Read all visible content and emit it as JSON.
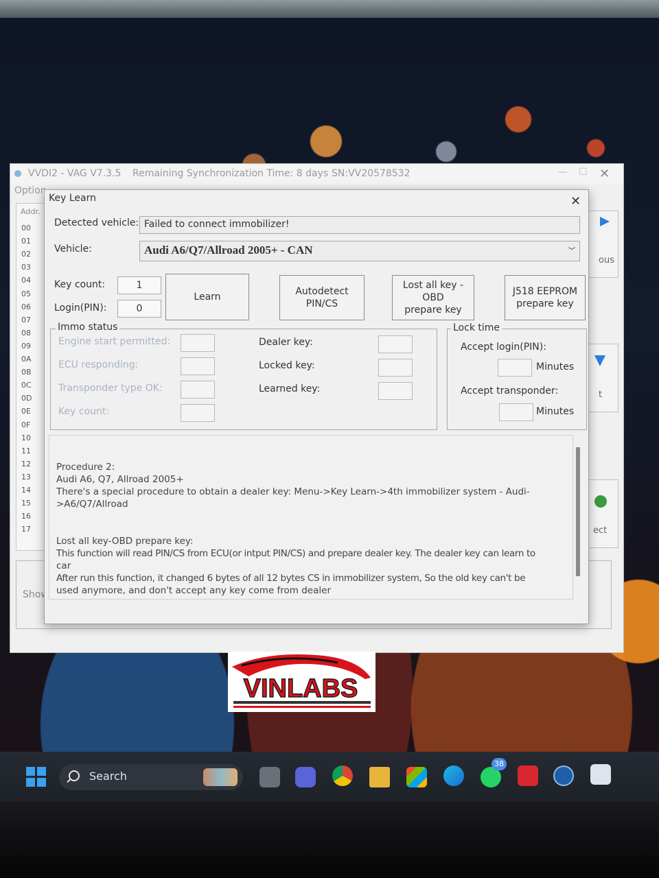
{
  "main_window": {
    "title": "VVDI2 - VAG V7.3.5",
    "sync_text": "Remaining Synchronization Time: 8 days",
    "serial": "SN:VV20578532",
    "menu_partial": "Option",
    "address_header": "Addr.",
    "address_rows": [
      "00",
      "01",
      "02",
      "03",
      "04",
      "05",
      "06",
      "07",
      "08",
      "09",
      "0A",
      "0B",
      "0C",
      "0D",
      "0E",
      "0F",
      "10",
      "11",
      "12",
      "13",
      "14",
      "15",
      "16",
      "17"
    ],
    "right_buttons": [
      "ous",
      "t",
      "ect"
    ],
    "show_label": "Show"
  },
  "dialog": {
    "title": "Key Learn",
    "detected_vehicle_label": "Detected vehicle:",
    "detected_vehicle_value": "Failed to connect immobilizer!",
    "vehicle_label": "Vehicle:",
    "vehicle_value": "Audi A6/Q7/Allroad 2005+ - CAN",
    "key_count_label": "Key count:",
    "key_count_value": "1",
    "login_label": "Login(PIN):",
    "login_value": "0",
    "buttons": {
      "learn": "Learn",
      "autodetect": "Autodetect\nPIN/CS",
      "lost_all": "Lost all key - OBD\nprepare key",
      "j518": "J518 EEPROM\nprepare key"
    },
    "immo_status": {
      "title": "Immo status",
      "engine_start": "Engine start permitted:",
      "ecu_responding": "ECU responding:",
      "transponder_ok": "Transponder type OK:",
      "key_count": "Key count:",
      "dealer_key": "Dealer key:",
      "locked_key": "Locked key:",
      "learned_key": "Learned key:"
    },
    "lock_time": {
      "title": "Lock time",
      "accept_login": "Accept login(PIN):",
      "accept_transponder": "Accept transponder:",
      "minutes1": "Minutes",
      "minutes2": "Minutes"
    },
    "info_text": [
      "Procedure 2:",
      "Audi A6, Q7, Allroad 2005+",
      "There's a special procedure to obtain a dealer key: Menu->Key Learn->4th immobilizer system - Audi-",
      ">A6/Q7/Allroad",
      "",
      "Lost all key-OBD prepare key:",
      "    This function will read PIN/CS from ECU(or intput PIN/CS) and prepare dealer key. The dealer key can learn to",
      "car",
      "    After run this function, it changed 6 bytes of all 12 bytes CS in immobilizer system,  So the old key can't be",
      "used anymore, and don't accept any key come from dealer"
    ]
  },
  "watermark": "VINLABS",
  "taskbar": {
    "search_label": "Search",
    "whatsapp_badge": "38"
  },
  "colors": {
    "dialog_bg": "#f0f0f0",
    "taskbar_bg": "#1f232a",
    "logo_red": "#d8141b"
  }
}
